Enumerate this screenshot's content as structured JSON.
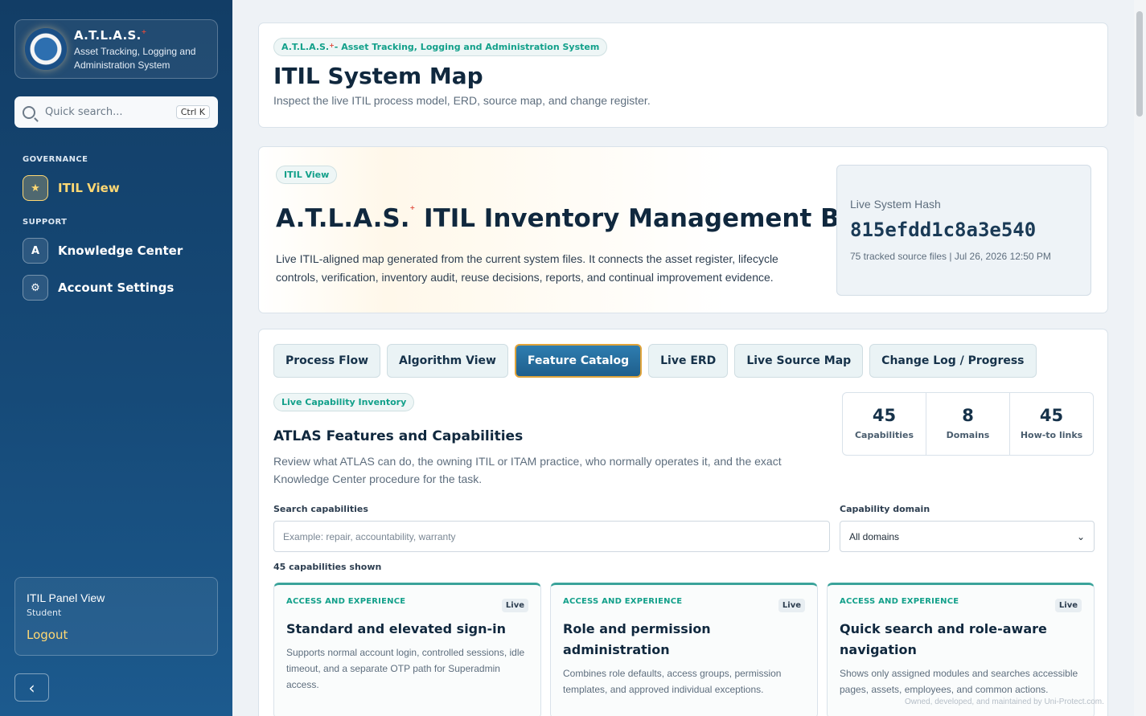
{
  "sidebar": {
    "brand_title": "A.T.L.A.S.",
    "brand_sup": "+",
    "brand_sub": "Asset Tracking, Logging and Administration System",
    "search_placeholder": "Quick search...",
    "search_shortcut": "Ctrl K",
    "section_governance": "GOVERNANCE",
    "section_support": "SUPPORT",
    "nav": [
      {
        "label": "ITIL View",
        "icon": "badge-icon",
        "active": true
      },
      {
        "label": "Knowledge Center",
        "icon": "book-icon"
      },
      {
        "label": "Account Settings",
        "icon": "settings-icon"
      }
    ],
    "user_view": "ITIL Panel View",
    "user_role": "Student",
    "logout": "Logout"
  },
  "header": {
    "pill_a": "A.T.L.A.S.",
    "pill_sup": "+",
    "pill_b": "- Asset Tracking, Logging and Administration System",
    "title": "ITIL System Map",
    "subtitle": "Inspect the live ITIL process model, ERD, source map, and change register."
  },
  "hero": {
    "pill": "ITIL View",
    "title_a": "A.T.L.A.S.",
    "title_sup": "+",
    "title_b": " ITIL Inventory Management Board",
    "description": "Live ITIL-aligned map generated from the current system files. It connects the asset register, lifecycle controls, verification, inventory audit, reuse decisions, reports, and continual improvement evidence.",
    "hash_label": "Live System Hash",
    "hash_value": "815efdd1c8a3e540",
    "hash_meta": "75 tracked source files | Jul 26, 2026 12:50 PM"
  },
  "tabs": [
    "Process Flow",
    "Algorithm View",
    "Feature Catalog",
    "Live ERD",
    "Live Source Map",
    "Change Log / Progress"
  ],
  "active_tab": "Feature Catalog",
  "catalog": {
    "pill": "Live Capability Inventory",
    "title": "ATLAS Features and Capabilities",
    "description": "Review what ATLAS can do, the owning ITIL or ITAM practice, who normally operates it, and the exact Knowledge Center procedure for the task.",
    "stats": [
      {
        "value": "45",
        "label": "Capabilities"
      },
      {
        "value": "8",
        "label": "Domains"
      },
      {
        "value": "45",
        "label": "How-to links"
      }
    ],
    "search_label": "Search capabilities",
    "search_placeholder": "Example: repair, accountability, warranty",
    "domain_label": "Capability domain",
    "domain_value": "All domains",
    "shown_count": "45 capabilities shown",
    "cards": [
      {
        "domain": "ACCESS AND EXPERIENCE",
        "badge": "Live",
        "title": "Standard and elevated sign-in",
        "desc": "Supports normal account login, controlled sessions, idle timeout, and a separate OTP path for Superadmin access."
      },
      {
        "domain": "ACCESS AND EXPERIENCE",
        "badge": "Live",
        "title": "Role and permission administration",
        "desc": "Combines role defaults, access groups, permission templates, and approved individual exceptions."
      },
      {
        "domain": "ACCESS AND EXPERIENCE",
        "badge": "Live",
        "title": "Quick search and role-aware navigation",
        "desc": "Shows only assigned modules and searches accessible pages, assets, employees, and common actions."
      }
    ]
  },
  "footer": "Owned, developed, and maintained by Uni-Protect.com."
}
